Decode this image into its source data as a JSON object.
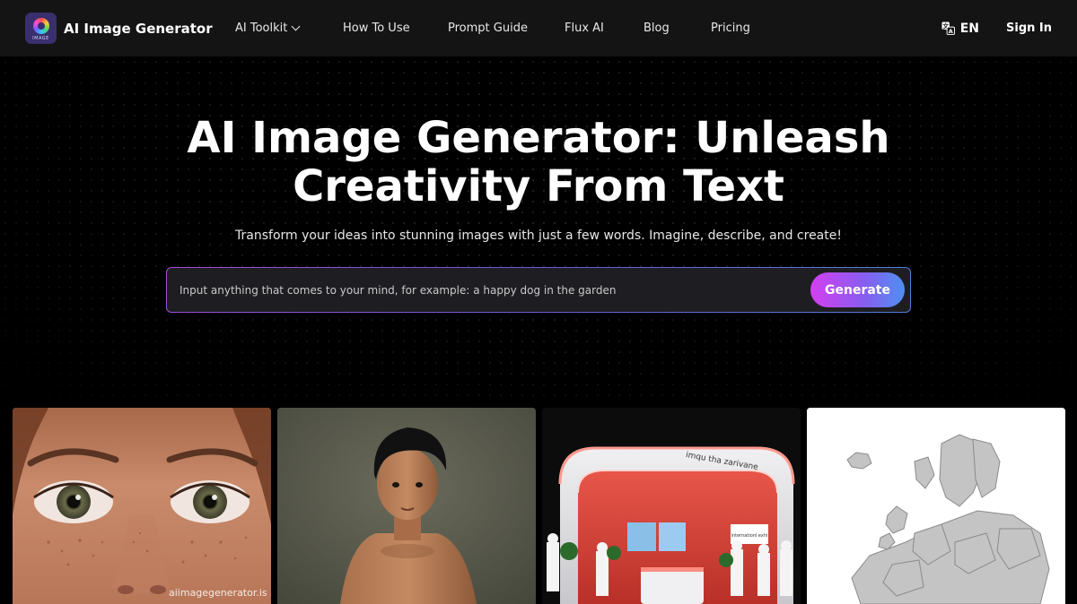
{
  "brand": {
    "name": "AI Image Generator",
    "logo_text": "IMAGE"
  },
  "nav": {
    "links": [
      {
        "label": "AI Toolkit",
        "dropdown": true
      },
      {
        "label": "How To Use"
      },
      {
        "label": "Prompt Guide"
      },
      {
        "label": "Flux AI"
      },
      {
        "label": "Blog"
      },
      {
        "label": "Pricing"
      }
    ],
    "language": "EN",
    "sign_in": "Sign In"
  },
  "hero": {
    "title_line1": "AI Image Generator: Unleash",
    "title_line2": "Creativity From Text",
    "subtitle": "Transform your ideas into stunning images with just a few words. Imagine, describe, and create!",
    "input_placeholder": "Input anything that comes to your mind, for example: a happy dog in the garden",
    "generate_label": "Generate"
  },
  "gallery": {
    "watermark": "aiimagegenerator.is",
    "card_3_text": "imqu tha zarivane",
    "card_3_small": "internationl exhi"
  },
  "colors": {
    "nav_bg": "#141414",
    "page_bg": "#000000",
    "accent_pink": "#d43ff0",
    "accent_blue": "#4f8ff2",
    "input_bg": "#1e1e22"
  }
}
